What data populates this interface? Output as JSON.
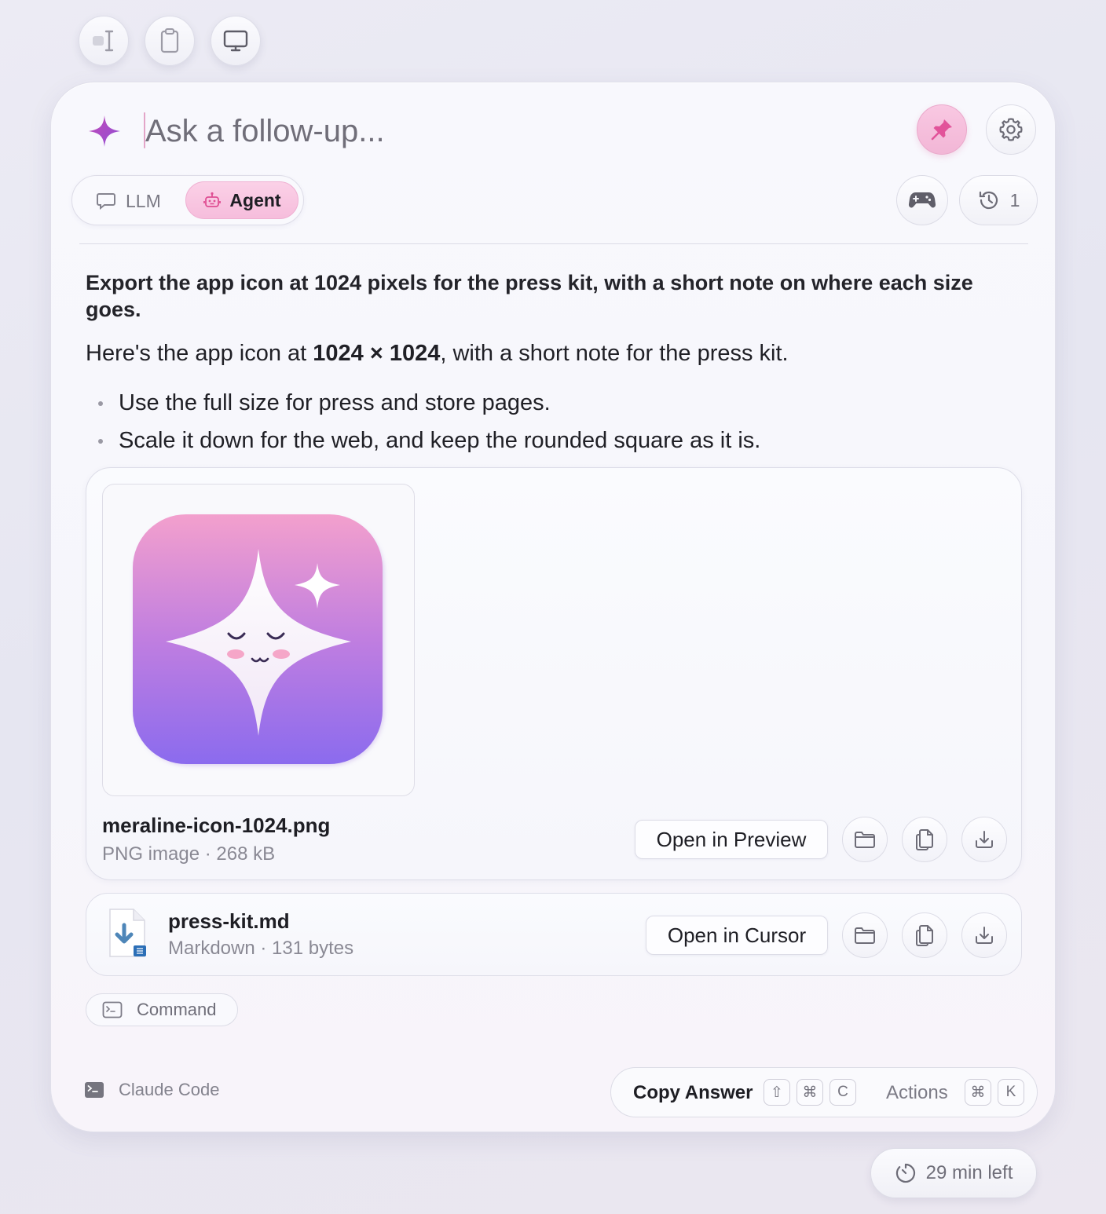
{
  "toolbar": {
    "buttons": [
      "text-cursor-icon",
      "clipboard-icon",
      "display-icon"
    ]
  },
  "composer": {
    "placeholder": "Ask a follow-up...",
    "pin_active": true
  },
  "modes": {
    "llm_label": "LLM",
    "agent_label": "Agent",
    "selected": "Agent"
  },
  "history": {
    "count": "1"
  },
  "conversation": {
    "prompt": "Export the app icon at 1024 pixels for the press kit, with a short note on where each size goes.",
    "answer_intro_before": "Here's the app icon at ",
    "answer_intro_bold": "1024 × 1024",
    "answer_intro_after": ", with a short note for the press kit.",
    "bullets": [
      "Use the full size for press and store pages.",
      "Scale it down for the web, and keep the rounded square as it is."
    ]
  },
  "attachments": [
    {
      "name": "meraline-icon-1024.png",
      "meta": "PNG image · 268 kB",
      "open_label": "Open in Preview"
    },
    {
      "name": "press-kit.md",
      "meta": "Markdown · 131 bytes",
      "open_label": "Open in Cursor"
    }
  ],
  "command_chip": {
    "label": "Command"
  },
  "footer": {
    "source_label": "Claude Code",
    "copy_answer_label": "Copy Answer",
    "copy_keys": [
      "⇧",
      "⌘",
      "C"
    ],
    "actions_label": "Actions",
    "actions_keys": [
      "⌘",
      "K"
    ]
  },
  "timer": {
    "label": "29 min left"
  },
  "colors": {
    "accent_pink": "#e2539a",
    "sparkle_purple": "#a548c9",
    "icon_gradient_top": "#f3a0cd",
    "icon_gradient_bottom": "#8b6bee"
  }
}
